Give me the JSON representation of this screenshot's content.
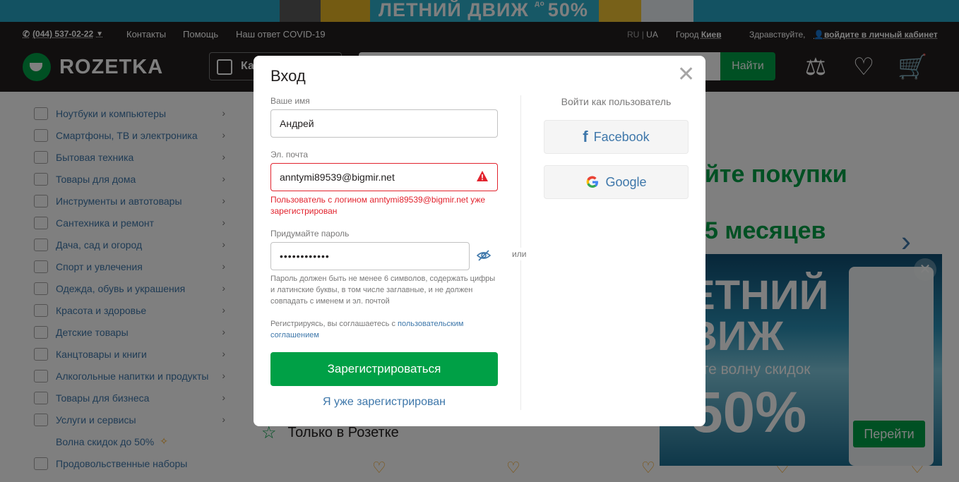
{
  "promo_top": {
    "text": "ЛЕТНИЙ ДВИЖ",
    "small": "до",
    "percent": "50%"
  },
  "header": {
    "phone": "(044) 537-02-22",
    "links": [
      "Контакты",
      "Помощь",
      "Наш ответ COVID-19"
    ],
    "lang_ru": "RU",
    "lang_sep": "|",
    "lang_ua": "UA",
    "city_label": "Город",
    "city_value": "Киев",
    "greeting": "Здравствуйте,",
    "login_link": "войдите в личный кабинет",
    "logo_text": "ROZETKA",
    "catalog_label": "Ка",
    "search_button": "Найти"
  },
  "sidebar": {
    "items": [
      {
        "label": "Ноутбуки и компьютеры"
      },
      {
        "label": "Смартфоны, ТВ и электроника"
      },
      {
        "label": "Бытовая техника"
      },
      {
        "label": "Товары для дома"
      },
      {
        "label": "Инструменты и автотовары"
      },
      {
        "label": "Сантехника и ремонт"
      },
      {
        "label": "Дача, сад и огород"
      },
      {
        "label": "Спорт и увлечения"
      },
      {
        "label": "Одежда, обувь и украшения"
      },
      {
        "label": "Красота и здоровье"
      },
      {
        "label": "Детские товары"
      },
      {
        "label": "Канцтовары и книги"
      },
      {
        "label": "Алкогольные напитки и продукты"
      },
      {
        "label": "Товары для бизнеса"
      },
      {
        "label": "Услуги и сервисы"
      },
      {
        "label": "Волна скидок до 50%"
      },
      {
        "label": "Продовольственные наборы"
      }
    ]
  },
  "banner": {
    "line1": "йте покупки",
    "line2": "5 месяцев"
  },
  "section": {
    "only_rozetka": "Только в Розетке"
  },
  "promo_popup": {
    "title1": "ЕТНИЙ",
    "title2": "ВИЖ",
    "subtitle": "йте волну скидок",
    "percent": "50%",
    "go_button": "Перейти"
  },
  "modal": {
    "title": "Вход",
    "name_label": "Ваше имя",
    "name_value": "Андрей",
    "email_label": "Эл. почта",
    "email_value": "anntymi89539@bigmir.net",
    "email_error": "Пользователь с логином anntymi89539@bigmir.net уже зарегистрирован",
    "password_label": "Придумайте пароль",
    "password_value": "••••••••••••",
    "password_hint": "Пароль должен быть не менее 6 символов, содержать цифры и латинские буквы, в том числе заглавные, и не должен совпадать с именем и эл. почтой",
    "agree_text": "Регистрируясь, вы соглашаетесь с",
    "agree_link": "пользовательским соглашением",
    "register_button": "Зарегистрироваться",
    "already_link": "Я уже зарегистрирован",
    "or_text": "или",
    "social_title": "Войти как пользователь",
    "facebook_label": "Facebook",
    "google_label": "Google"
  },
  "colors": {
    "brand_green": "#00a046",
    "header_bg": "#221f1f",
    "link_blue": "#3e77aa",
    "error_red": "#e2232e"
  }
}
